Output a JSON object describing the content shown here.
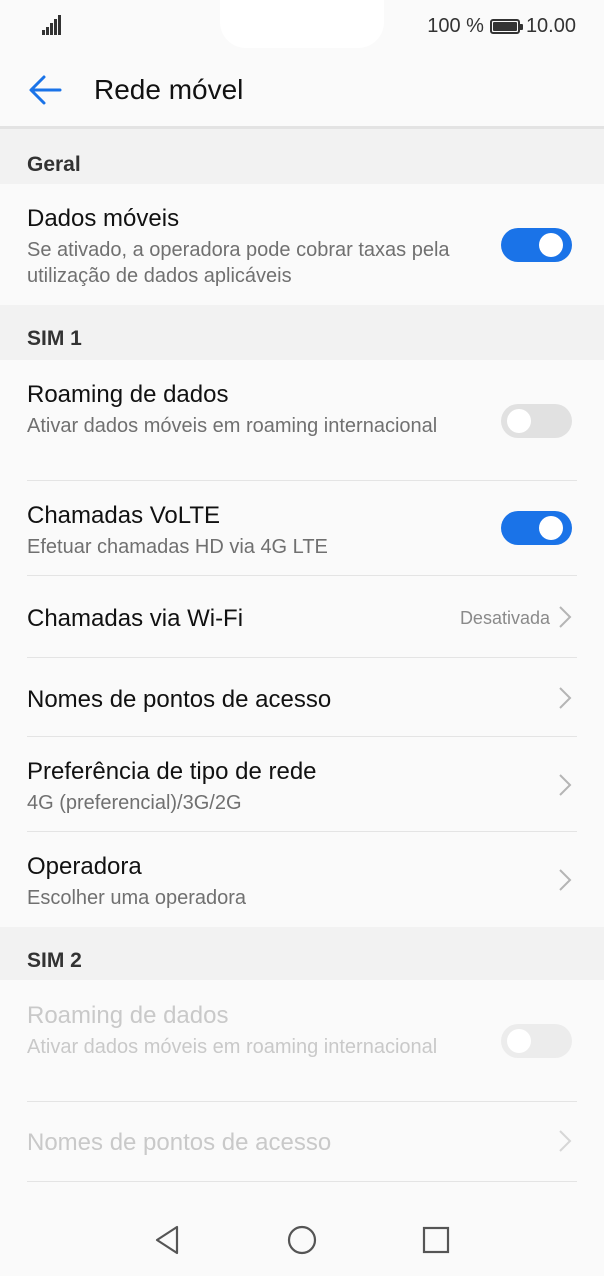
{
  "status": {
    "battery_text": "100 %",
    "time": "10.00"
  },
  "header": {
    "title": "Rede móvel"
  },
  "sections": {
    "general": "Geral",
    "sim1": "SIM 1",
    "sim2": "SIM 2"
  },
  "general_items": {
    "mobile_data": {
      "title": "Dados móveis",
      "subtitle": "Se ativado, a operadora pode cobrar taxas pela utilização de dados aplicáveis",
      "enabled": true
    }
  },
  "sim1_items": {
    "roaming": {
      "title": "Roaming de dados",
      "subtitle": "Ativar dados móveis em roaming internacional",
      "enabled": false
    },
    "volte": {
      "title": "Chamadas VoLTE",
      "subtitle": "Efetuar chamadas HD via 4G LTE",
      "enabled": true
    },
    "wifi_calls": {
      "title": "Chamadas via Wi-Fi",
      "value": "Desativada"
    },
    "apn": {
      "title": "Nomes de pontos de acesso"
    },
    "network_type": {
      "title": "Preferência de tipo de rede",
      "subtitle": "4G (preferencial)/3G/2G"
    },
    "operator": {
      "title": "Operadora",
      "subtitle": "Escolher uma operadora"
    }
  },
  "sim2_items": {
    "roaming": {
      "title": "Roaming de dados",
      "subtitle": "Ativar dados móveis em roaming internacional",
      "enabled": false,
      "disabled": true
    },
    "apn": {
      "title": "Nomes de pontos de acesso",
      "disabled": true
    }
  },
  "colors": {
    "accent": "#1a73e8",
    "toggle_off": "#e1e1e1",
    "section_bg": "#f2f2f2"
  },
  "icons": [
    "signal-icon",
    "battery-icon",
    "back-arrow-icon",
    "chevron-right-icon",
    "nav-back-icon",
    "nav-home-icon",
    "nav-recents-icon"
  ]
}
